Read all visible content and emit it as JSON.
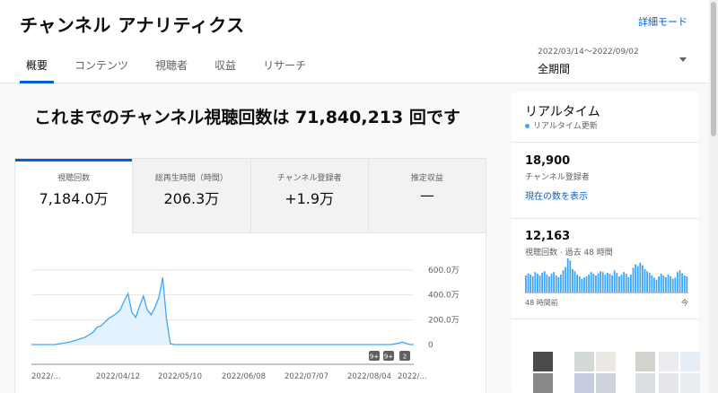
{
  "header": {
    "title": "チャンネル アナリティクス",
    "advanced_mode": "詳細モード",
    "tabs": [
      {
        "label": "概要",
        "active": true
      },
      {
        "label": "コンテンツ",
        "active": false
      },
      {
        "label": "視聴者",
        "active": false
      },
      {
        "label": "収益",
        "active": false
      },
      {
        "label": "リサーチ",
        "active": false
      }
    ],
    "date_range": "2022/03/14～2022/09/02",
    "period": "全期間"
  },
  "headline": "これまでのチャンネル視聴回数は 71,840,213 回です",
  "metrics": [
    {
      "label": "視聴回数",
      "value": "7,184.0万",
      "active": true
    },
    {
      "label": "総再生時間（時間）",
      "value": "206.3万",
      "active": false
    },
    {
      "label": "チャンネル登録者",
      "value": "+1.9万",
      "active": false
    },
    {
      "label": "推定収益",
      "value": "—",
      "active": false
    }
  ],
  "chart_data": {
    "type": "area",
    "series": [
      {
        "values": [
          0,
          0,
          0,
          0,
          0,
          0,
          0,
          0.05,
          0.1,
          0.15,
          0.2,
          0.3,
          0.4,
          0.5,
          0.6,
          0.8,
          1.0,
          1.4,
          1.5,
          1.8,
          2.1,
          2.3,
          2.5,
          2.8,
          3.5,
          4.1,
          2.6,
          2.2,
          3.1,
          3.9,
          2.8,
          2.4,
          3.0,
          3.8,
          5.4,
          2.0,
          0.05,
          0,
          0,
          0,
          0,
          0,
          0,
          0,
          0,
          0,
          0,
          0,
          0,
          0,
          0,
          0,
          0,
          0,
          0,
          0,
          0,
          0,
          0,
          0,
          0,
          0,
          0,
          0,
          0,
          0,
          0,
          0,
          0,
          0,
          0,
          0,
          0,
          0,
          0,
          0,
          0,
          0,
          0,
          0,
          0,
          0,
          0,
          0,
          0,
          0,
          0,
          0,
          0,
          0,
          0,
          0,
          0,
          0,
          0.05,
          0.1,
          0.2,
          0.1,
          0,
          0
        ]
      }
    ],
    "x_tick_labels": [
      "2022/...",
      "2022/04/12",
      "2022/05/10",
      "2022/06/08",
      "2022/07/07",
      "2022/08/04",
      "2022/..."
    ],
    "y_tick_labels": [
      "600.0万",
      "400.0万",
      "200.0万",
      "0"
    ],
    "ylim": [
      0,
      6
    ],
    "y_unit": "百万",
    "markers": [
      "9+",
      "9+",
      "2"
    ],
    "colors": {
      "line": "#3ea6ff",
      "fill": "#e3f2fd",
      "grid": "#e5e5e5"
    }
  },
  "realtime": {
    "title": "リアルタイム",
    "subtitle": "リアルタイム更新",
    "subscribers_value": "18,900",
    "subscribers_label": "チャンネル登録者",
    "link": "現在の数を表示",
    "views_value": "12,163",
    "views_label": "視聴回数 · 過去 48 時間",
    "range_start": "48 時間前",
    "range_end": "今",
    "bars": [
      40,
      45,
      42,
      38,
      48,
      44,
      40,
      46,
      50,
      42,
      38,
      44,
      48,
      40,
      36,
      42,
      52,
      60,
      80,
      75,
      55,
      50,
      42,
      38,
      32,
      35,
      38,
      42,
      48,
      44,
      40,
      45,
      50,
      48,
      42,
      46,
      44,
      40,
      52,
      46,
      38,
      42,
      48,
      44,
      36,
      42,
      58,
      66,
      62,
      70,
      64,
      55,
      50,
      46,
      40,
      35,
      30,
      38,
      44,
      40,
      36,
      42,
      38,
      32,
      35,
      48,
      52,
      45,
      40,
      38
    ],
    "bar_color": "#3ea6ff"
  },
  "thumb_colors": [
    "#4a4a4c",
    "#d4dbd6",
    "#ece8e4",
    "#d0d4cc",
    "#ecedf0",
    "#e6eefa",
    "#8a8886",
    "#c6cce0",
    "#cfd3de",
    "#dcdfe2",
    "#e4e6ea",
    "#e8eef2"
  ]
}
